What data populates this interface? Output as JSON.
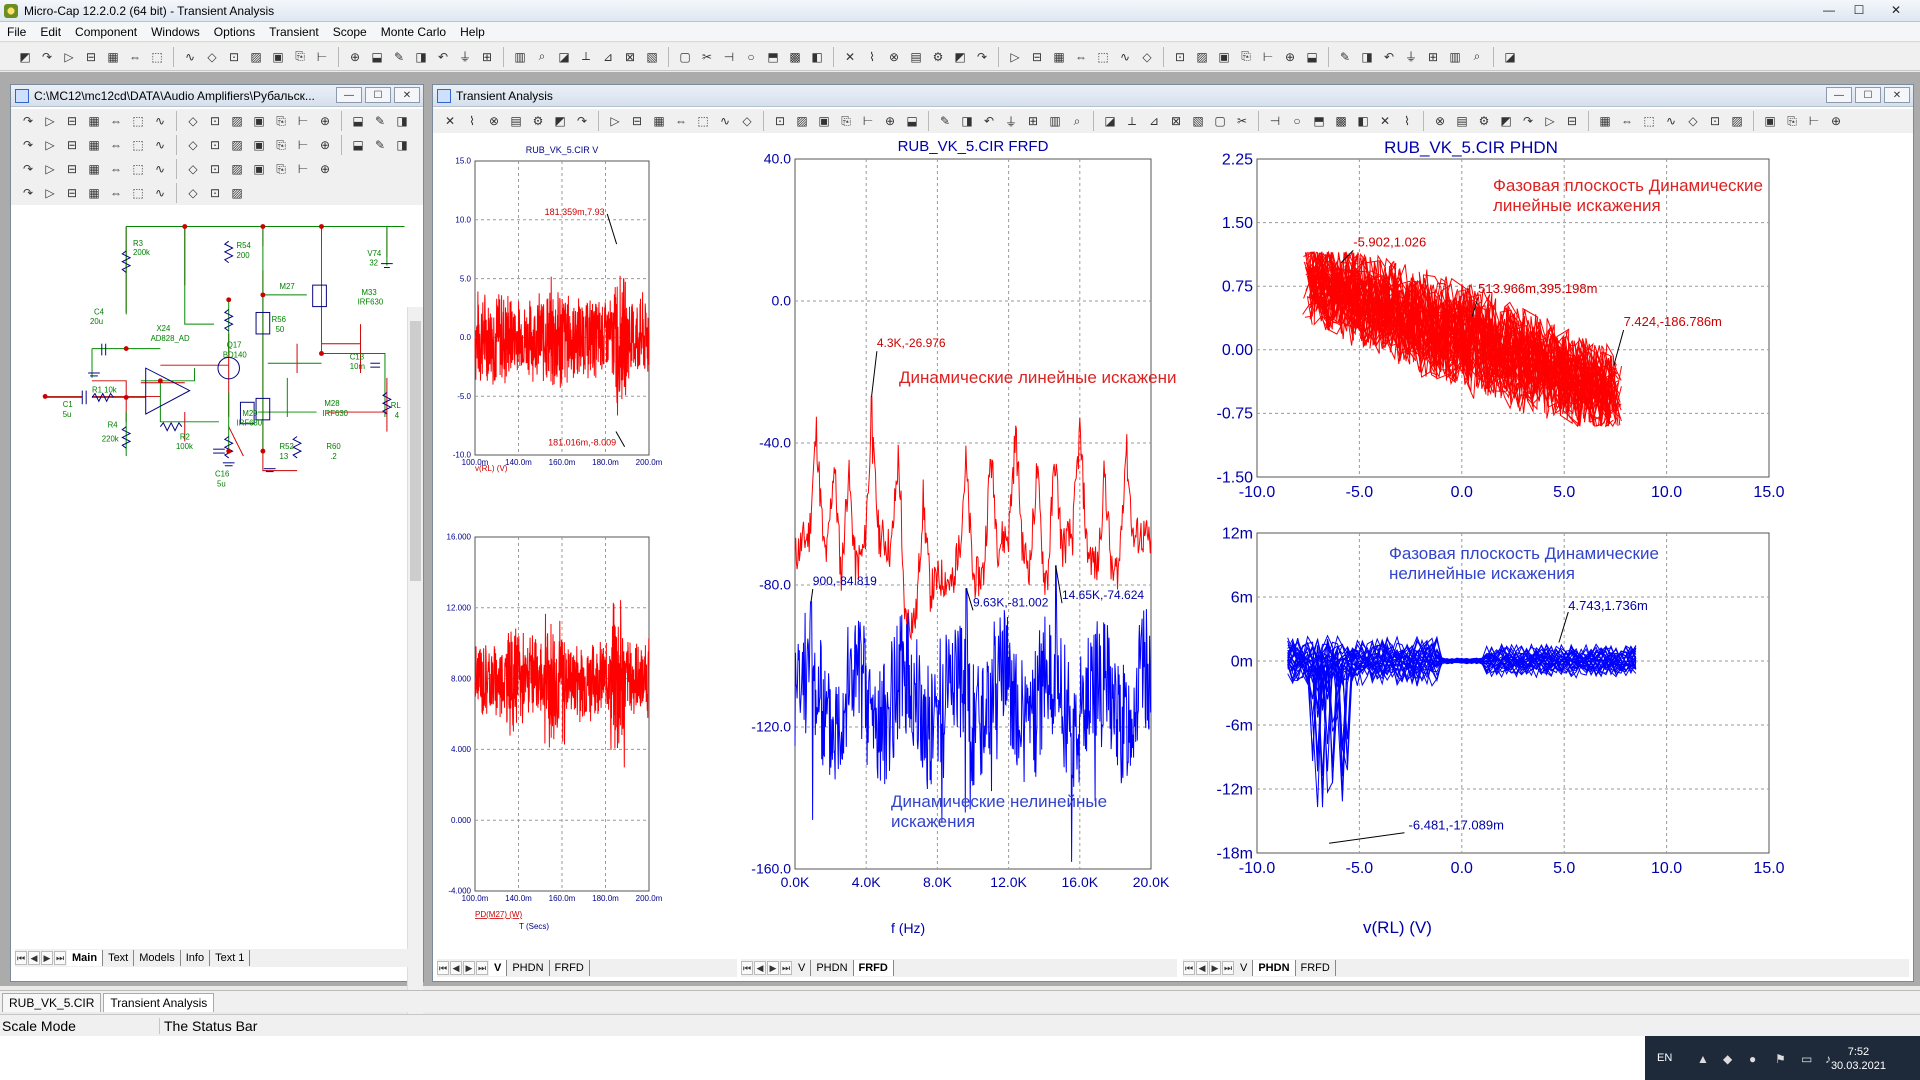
{
  "app": {
    "title": "Micro-Cap 12.2.0.2 (64 bit) - Transient Analysis",
    "win_min": "—",
    "win_max": "☐",
    "win_close": "✕"
  },
  "menu": [
    "File",
    "Edit",
    "Component",
    "Windows",
    "Options",
    "Transient",
    "Scope",
    "Monte Carlo",
    "Help"
  ],
  "schematic_window": {
    "title": "C:\\MC12\\mc12cd\\DATA\\Audio Amplifiers\\Рубальск...",
    "tabs": [
      "Main",
      "Text",
      "Models",
      "Info",
      "Text 1"
    ],
    "active_tab": "Main",
    "components": {
      "R3": "R3",
      "R3v": "200k",
      "C4": "C4",
      "C4v": "20u",
      "X24": "X24",
      "X24v": "AD828_AD",
      "R1": "R1 10k",
      "C1": "C1",
      "C1v": "5u",
      "R4": "R4",
      "R4v": "220k",
      "R2": "R2",
      "R2v": "100k",
      "R54": "R54",
      "R54v": "200",
      "Q17": "Q17",
      "Q17v": "BD140",
      "R56": "R56",
      "R56v": "50",
      "M27": "M27",
      "M33": "M33",
      "M33v": "IRF630",
      "V74": "V74",
      "V74v": "32",
      "C13": "C13",
      "C13v": "10m",
      "RL": "RL",
      "RLv": "4",
      "M29": "M29",
      "M29v": "IRF630",
      "M28": "M28",
      "M28v": "IRF630",
      "R52": "R52",
      "R52v": "13",
      "R60": "R60",
      "R60v": ".2",
      "C16": "C16",
      "C16v": "5u"
    }
  },
  "transient_window": {
    "title": "Transient Analysis",
    "left_tabs": [
      "V",
      "PHDN",
      "FRFD"
    ],
    "left_active": "V",
    "mid_tabs": [
      "V",
      "PHDN",
      "FRFD"
    ],
    "mid_active": "FRFD",
    "right_tabs": [
      "V",
      "PHDN",
      "FRFD"
    ],
    "right_active": "PHDN"
  },
  "chart_data": [
    {
      "id": "v-top",
      "type": "line",
      "title": "RUB_VK_5.CIR V",
      "xlabel": "v(RL) (V)",
      "ylabel": "",
      "xlim": [
        100,
        200
      ],
      "ylim": [
        -10,
        15
      ],
      "x_ticks": [
        "100.0m",
        "140.0m",
        "160.0m",
        "180.0m",
        "200.0m"
      ],
      "y_ticks": [
        "15.0",
        "10.0",
        "5.0",
        "0.0",
        "-5.0",
        "-10.0"
      ],
      "series": [
        {
          "color": "#ff0000",
          "envelope": [
            [
              100,
              4.5
            ],
            [
              110,
              4.5
            ],
            [
              118,
              5.0
            ],
            [
              122,
              3.5
            ],
            [
              130,
              3.5
            ],
            [
              140,
              4.5
            ],
            [
              148,
              6.5
            ],
            [
              152,
              4.5
            ],
            [
              160,
              3.8
            ],
            [
              170,
              3.8
            ],
            [
              180,
              4.0
            ],
            [
              181,
              7.9
            ],
            [
              186,
              5.5
            ],
            [
              190,
              4.0
            ],
            [
              200,
              4.0
            ]
          ]
        }
      ],
      "annotations": [
        "181.359m,7.93",
        "181.016m,-8.009"
      ],
      "grid": true
    },
    {
      "id": "pd-bottom",
      "type": "line",
      "title": "",
      "xlabel": "T (Secs)",
      "xlabel_series": "PD(M27) (W)",
      "xlim": [
        100,
        200
      ],
      "ylim": [
        -4,
        16
      ],
      "x_ticks": [
        "100.0m",
        "140.0m",
        "160.0m",
        "180.0m",
        "200.0m"
      ],
      "y_ticks": [
        "16.000",
        "12.000",
        "8.000",
        "4.000",
        "0.000",
        "-4.000"
      ],
      "series": [
        {
          "color": "#ff0000",
          "center": 8.0
        }
      ],
      "grid": true
    },
    {
      "id": "frfd",
      "type": "line",
      "title": "RUB_VK_5.CIR FRFD",
      "xlabel": "f (Hz)",
      "xlim": [
        0,
        20
      ],
      "ylim": [
        -160,
        40
      ],
      "x_ticks": [
        "0.0K",
        "4.0K",
        "8.0K",
        "12.0K",
        "16.0K",
        "20.0K"
      ],
      "y_ticks": [
        "40.0",
        "0.0",
        "-40.0",
        "-80.0",
        "-120.0",
        "-160.0"
      ],
      "series": [
        {
          "color": "#ff0000",
          "label": "Динамические линейные искажения"
        },
        {
          "color": "#0000ff",
          "label": "Динамические нелинейные искажения"
        }
      ],
      "annotations": [
        "4.3K,-26.976",
        "900,-84.819",
        "9.63K,-81.002",
        "14.65K,-74.624"
      ],
      "grid": true
    },
    {
      "id": "phdn-top",
      "type": "scatter",
      "title": "RUB_VK_5.CIR PHDN",
      "xlim": [
        -10,
        15
      ],
      "ylim": [
        -1.5,
        2.25
      ],
      "x_ticks": [
        "-10.0",
        "-5.0",
        "0.0",
        "5.0",
        "10.0",
        "15.0"
      ],
      "y_ticks": [
        "2.25",
        "1.50",
        "0.75",
        "0.00",
        "-0.75",
        "-1.50"
      ],
      "series": [
        {
          "color": "#ff0000",
          "label": "Фазовая плоскость Динамические линейные искажения"
        }
      ],
      "annotations": [
        "-5.902,1.026",
        "513.966m,395.198m",
        "7.424,-186.786m"
      ],
      "grid": true
    },
    {
      "id": "phdn-bottom",
      "type": "scatter",
      "title": "",
      "xlabel": "v(RL) (V)",
      "xlim": [
        -10,
        15
      ],
      "ylim": [
        -18,
        12
      ],
      "x_ticks": [
        "-10.0",
        "-5.0",
        "0.0",
        "5.0",
        "10.0",
        "15.0"
      ],
      "y_ticks": [
        "12m",
        "6m",
        "0m",
        "-6m",
        "-12m",
        "-18m"
      ],
      "series": [
        {
          "color": "#0000ff",
          "label": "Фазовая плоскость Динамические нелинейные искажения"
        }
      ],
      "annotations": [
        "4.743,1.736m",
        "-6.481,-17.089m"
      ],
      "grid": true
    }
  ],
  "texts": {
    "frfd_red_label": "Динамические линейные искажения",
    "frfd_blue_label_1": "Динамические нелинейные",
    "frfd_blue_label_2": "искажения",
    "phdn_red_label_1": "Фазовая плоскость Динамические",
    "phdn_red_label_2": "линейные искажения",
    "phdn_blue_label_1": "Фазовая плоскость Динамические",
    "phdn_blue_label_2": "нелинейные искажения"
  },
  "status_tabs": [
    "RUB_VK_5.CIR",
    "Transient Analysis"
  ],
  "status_active": "Transient Analysis",
  "statusbar": {
    "mode": "Scale Mode",
    "text": "The Status Bar"
  },
  "tray": {
    "lang": "EN",
    "time": "7:52",
    "date": "30.03.2021"
  },
  "colors": {
    "red": "#ff0000",
    "blue": "#0000ff",
    "grid": "#9a9a9a",
    "axis_text": "#00008b"
  }
}
